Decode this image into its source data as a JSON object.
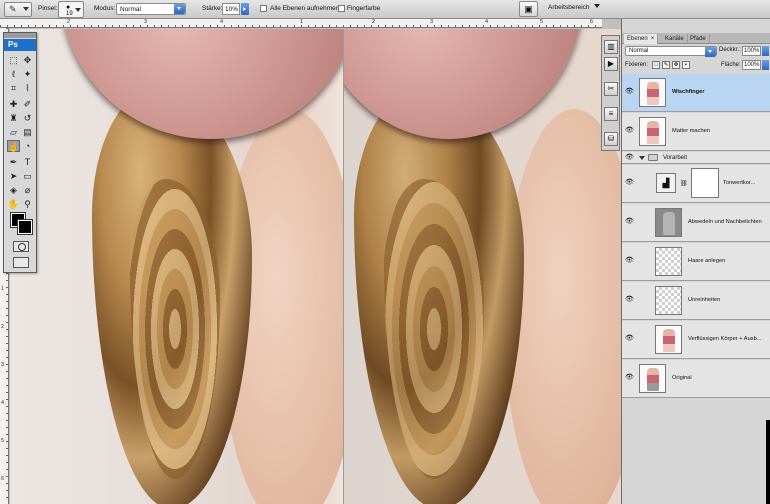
{
  "options_bar": {
    "tool_glyph": "✎",
    "brush_label": "Pinsel:",
    "brush_size": "19",
    "mode_label": "Modus:",
    "mode_value": "Normal",
    "strength_label": "Stärke:",
    "strength_value": "10%",
    "all_layers_label": "Alle Ebenen aufnehmen",
    "finger_paint_label": "Fingerfarbe",
    "workspace_label": "Arbeitsbereich"
  },
  "rulers": {
    "top_ticks": [
      "2",
      "3",
      "4",
      "1",
      "2",
      "3",
      "4",
      "5",
      "6"
    ],
    "left_ticks": [
      "1",
      "2",
      "3",
      "4",
      "5",
      "6",
      "7",
      "8"
    ]
  },
  "toolbox": {
    "logo": "Ps"
  },
  "layers_panel": {
    "tabs": [
      {
        "label": "Ebenen"
      },
      {
        "label": "Kanäle"
      },
      {
        "label": "Pfade"
      }
    ],
    "blend_mode": "Normal",
    "opacity_label": "Deckkr.:",
    "opacity_value": "100%",
    "lock_label": "Fixieren:",
    "fill_label": "Fläche:",
    "fill_value": "100%",
    "layers": [
      {
        "name": "Wischfinger"
      },
      {
        "name": "Matter machen"
      },
      {
        "name": "Vorarbeit"
      },
      {
        "name": "Tonwertkor..."
      },
      {
        "name": "Abwedeln und Nachbelichten"
      },
      {
        "name": "Haare anlegen"
      },
      {
        "name": "Unreinheiten"
      },
      {
        "name": "Verflüssigen Körper + Ausb..."
      },
      {
        "name": "Original"
      }
    ]
  },
  "colors": {
    "selection": "#b9d5f2",
    "accent_blue": "#2f66c0",
    "ps_logo_bg": "#1f6fc6"
  }
}
